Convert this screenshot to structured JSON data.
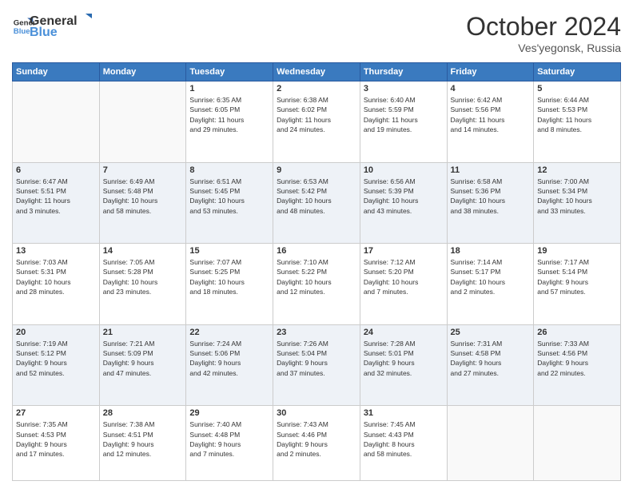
{
  "logo": {
    "line1": "General",
    "line2": "Blue"
  },
  "title": "October 2024",
  "location": "Ves'yegonsk, Russia",
  "days_header": [
    "Sunday",
    "Monday",
    "Tuesday",
    "Wednesday",
    "Thursday",
    "Friday",
    "Saturday"
  ],
  "weeks": [
    [
      {
        "num": "",
        "info": ""
      },
      {
        "num": "",
        "info": ""
      },
      {
        "num": "1",
        "info": "Sunrise: 6:35 AM\nSunset: 6:05 PM\nDaylight: 11 hours\nand 29 minutes."
      },
      {
        "num": "2",
        "info": "Sunrise: 6:38 AM\nSunset: 6:02 PM\nDaylight: 11 hours\nand 24 minutes."
      },
      {
        "num": "3",
        "info": "Sunrise: 6:40 AM\nSunset: 5:59 PM\nDaylight: 11 hours\nand 19 minutes."
      },
      {
        "num": "4",
        "info": "Sunrise: 6:42 AM\nSunset: 5:56 PM\nDaylight: 11 hours\nand 14 minutes."
      },
      {
        "num": "5",
        "info": "Sunrise: 6:44 AM\nSunset: 5:53 PM\nDaylight: 11 hours\nand 8 minutes."
      }
    ],
    [
      {
        "num": "6",
        "info": "Sunrise: 6:47 AM\nSunset: 5:51 PM\nDaylight: 11 hours\nand 3 minutes."
      },
      {
        "num": "7",
        "info": "Sunrise: 6:49 AM\nSunset: 5:48 PM\nDaylight: 10 hours\nand 58 minutes."
      },
      {
        "num": "8",
        "info": "Sunrise: 6:51 AM\nSunset: 5:45 PM\nDaylight: 10 hours\nand 53 minutes."
      },
      {
        "num": "9",
        "info": "Sunrise: 6:53 AM\nSunset: 5:42 PM\nDaylight: 10 hours\nand 48 minutes."
      },
      {
        "num": "10",
        "info": "Sunrise: 6:56 AM\nSunset: 5:39 PM\nDaylight: 10 hours\nand 43 minutes."
      },
      {
        "num": "11",
        "info": "Sunrise: 6:58 AM\nSunset: 5:36 PM\nDaylight: 10 hours\nand 38 minutes."
      },
      {
        "num": "12",
        "info": "Sunrise: 7:00 AM\nSunset: 5:34 PM\nDaylight: 10 hours\nand 33 minutes."
      }
    ],
    [
      {
        "num": "13",
        "info": "Sunrise: 7:03 AM\nSunset: 5:31 PM\nDaylight: 10 hours\nand 28 minutes."
      },
      {
        "num": "14",
        "info": "Sunrise: 7:05 AM\nSunset: 5:28 PM\nDaylight: 10 hours\nand 23 minutes."
      },
      {
        "num": "15",
        "info": "Sunrise: 7:07 AM\nSunset: 5:25 PM\nDaylight: 10 hours\nand 18 minutes."
      },
      {
        "num": "16",
        "info": "Sunrise: 7:10 AM\nSunset: 5:22 PM\nDaylight: 10 hours\nand 12 minutes."
      },
      {
        "num": "17",
        "info": "Sunrise: 7:12 AM\nSunset: 5:20 PM\nDaylight: 10 hours\nand 7 minutes."
      },
      {
        "num": "18",
        "info": "Sunrise: 7:14 AM\nSunset: 5:17 PM\nDaylight: 10 hours\nand 2 minutes."
      },
      {
        "num": "19",
        "info": "Sunrise: 7:17 AM\nSunset: 5:14 PM\nDaylight: 9 hours\nand 57 minutes."
      }
    ],
    [
      {
        "num": "20",
        "info": "Sunrise: 7:19 AM\nSunset: 5:12 PM\nDaylight: 9 hours\nand 52 minutes."
      },
      {
        "num": "21",
        "info": "Sunrise: 7:21 AM\nSunset: 5:09 PM\nDaylight: 9 hours\nand 47 minutes."
      },
      {
        "num": "22",
        "info": "Sunrise: 7:24 AM\nSunset: 5:06 PM\nDaylight: 9 hours\nand 42 minutes."
      },
      {
        "num": "23",
        "info": "Sunrise: 7:26 AM\nSunset: 5:04 PM\nDaylight: 9 hours\nand 37 minutes."
      },
      {
        "num": "24",
        "info": "Sunrise: 7:28 AM\nSunset: 5:01 PM\nDaylight: 9 hours\nand 32 minutes."
      },
      {
        "num": "25",
        "info": "Sunrise: 7:31 AM\nSunset: 4:58 PM\nDaylight: 9 hours\nand 27 minutes."
      },
      {
        "num": "26",
        "info": "Sunrise: 7:33 AM\nSunset: 4:56 PM\nDaylight: 9 hours\nand 22 minutes."
      }
    ],
    [
      {
        "num": "27",
        "info": "Sunrise: 7:35 AM\nSunset: 4:53 PM\nDaylight: 9 hours\nand 17 minutes."
      },
      {
        "num": "28",
        "info": "Sunrise: 7:38 AM\nSunset: 4:51 PM\nDaylight: 9 hours\nand 12 minutes."
      },
      {
        "num": "29",
        "info": "Sunrise: 7:40 AM\nSunset: 4:48 PM\nDaylight: 9 hours\nand 7 minutes."
      },
      {
        "num": "30",
        "info": "Sunrise: 7:43 AM\nSunset: 4:46 PM\nDaylight: 9 hours\nand 2 minutes."
      },
      {
        "num": "31",
        "info": "Sunrise: 7:45 AM\nSunset: 4:43 PM\nDaylight: 8 hours\nand 58 minutes."
      },
      {
        "num": "",
        "info": ""
      },
      {
        "num": "",
        "info": ""
      }
    ]
  ]
}
